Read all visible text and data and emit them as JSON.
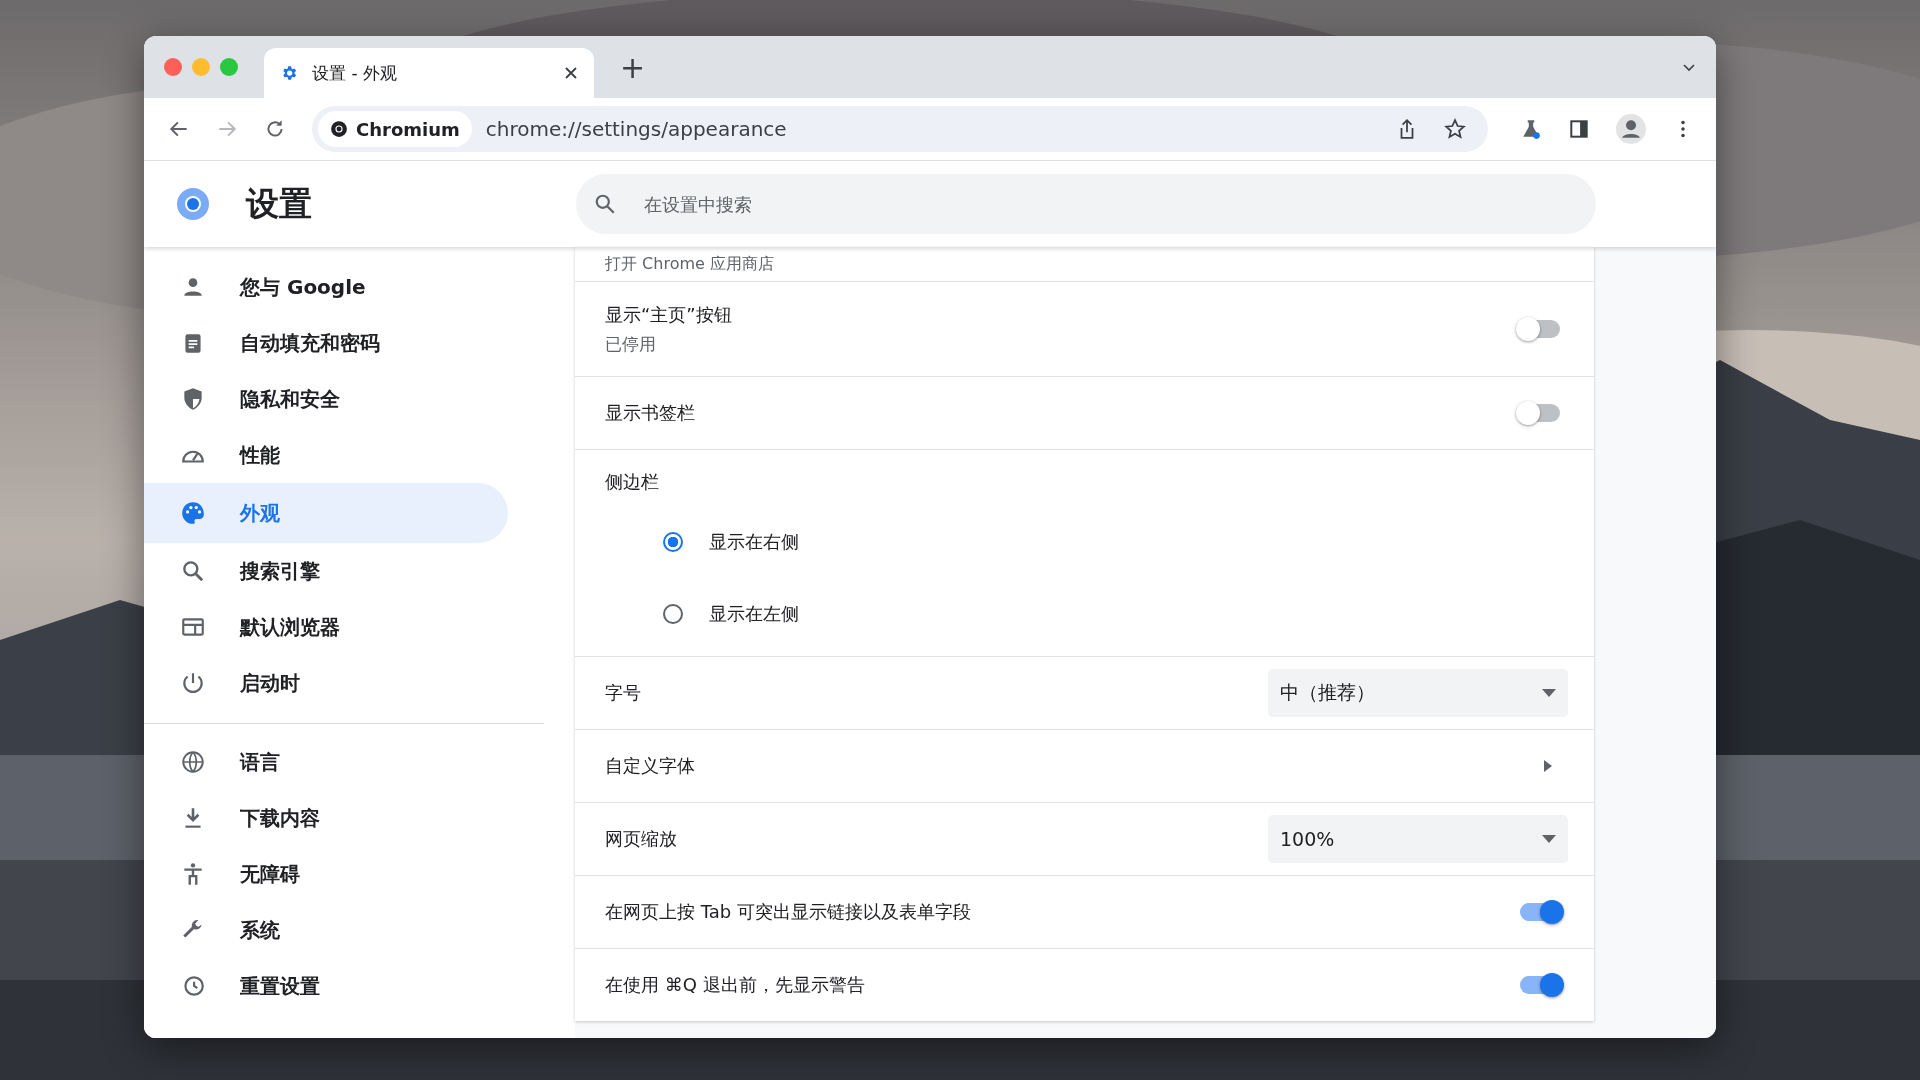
{
  "browser": {
    "tab_title": "设置 - 外观",
    "new_tab": "+",
    "site_chip": "Chromium",
    "url": "chrome://settings/appearance"
  },
  "header": {
    "title": "设置",
    "search": {
      "placeholder": "在设置中搜索"
    }
  },
  "sidebar": {
    "groups": [
      [
        {
          "label": "您与 Google",
          "selected": false
        },
        {
          "label": "自动填充和密码",
          "selected": false
        },
        {
          "label": "隐私和安全",
          "selected": false
        },
        {
          "label": "性能",
          "selected": false
        },
        {
          "label": "外观",
          "selected": true
        },
        {
          "label": "搜索引擎",
          "selected": false
        },
        {
          "label": "默认浏览器",
          "selected": false
        },
        {
          "label": "启动时",
          "selected": false
        }
      ],
      [
        {
          "label": "语言",
          "selected": false
        },
        {
          "label": "下载内容",
          "selected": false
        },
        {
          "label": "无障碍",
          "selected": false
        },
        {
          "label": "系统",
          "selected": false
        },
        {
          "label": "重置设置",
          "selected": false
        }
      ]
    ]
  },
  "settings": [
    {
      "kind": "caption",
      "label": "打开 Chrome 应用商店"
    },
    {
      "kind": "toggle",
      "label": "显示“主页”按钮",
      "sublabel": "已停用",
      "on": false
    },
    {
      "kind": "toggle",
      "label": "显示书签栏",
      "on": false
    },
    {
      "kind": "radio_group",
      "label": "侧边栏",
      "options": [
        {
          "label": "显示在右侧",
          "selected": true
        },
        {
          "label": "显示在左侧",
          "selected": false
        }
      ]
    },
    {
      "kind": "select",
      "label": "字号",
      "value": "中（推荐）"
    },
    {
      "kind": "link",
      "label": "自定义字体"
    },
    {
      "kind": "select",
      "label": "网页缩放",
      "value": "100%"
    },
    {
      "kind": "toggle",
      "label": "在网页上按 Tab 可突出显示链接以及表单字段",
      "on": true
    },
    {
      "kind": "toggle",
      "label": "在使用 ⌘Q 退出前，先显示警告",
      "on": true
    }
  ]
}
